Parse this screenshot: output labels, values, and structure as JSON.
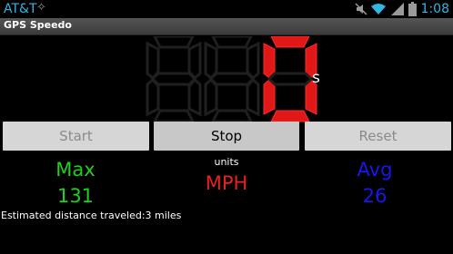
{
  "status_bar": {
    "carrier": "AT&T",
    "carrier_icon": "usb-debug-icon",
    "icons": [
      "mute-icon",
      "wifi-icon",
      "signal-icon",
      "battery-icon"
    ],
    "time": "1:08"
  },
  "app": {
    "title": "GPS Speedo"
  },
  "speedometer": {
    "digits": [
      "8",
      "8",
      "0"
    ],
    "lit": [
      false,
      false,
      true
    ],
    "suffix": "s",
    "lit_color": "#e01818",
    "unlit_color": "#1f1f1f"
  },
  "buttons": {
    "start": {
      "label": "Start",
      "enabled": false
    },
    "stop": {
      "label": "Stop",
      "enabled": true
    },
    "reset": {
      "label": "Reset",
      "enabled": false
    }
  },
  "stats": {
    "max_label": "Max",
    "max_value": "131",
    "units_label": "units",
    "units_value": "MPH",
    "avg_label": "Avg",
    "avg_value": "26"
  },
  "distance_text": "Estimated distance traveled:3 miles",
  "colors": {
    "accent": "#33b5e5",
    "max": "#19d219",
    "avg": "#1717ee",
    "units": "#e82020"
  }
}
